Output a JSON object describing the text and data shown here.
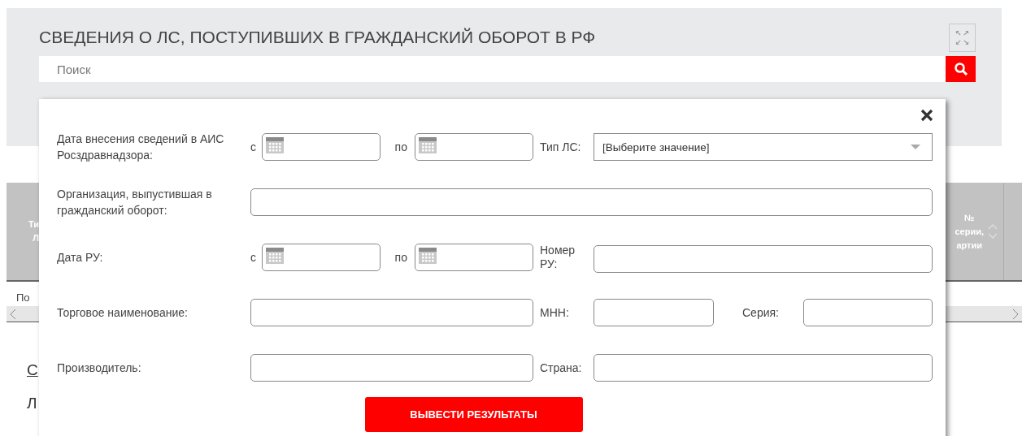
{
  "header": {
    "title": "СВЕДЕНИЯ О ЛС, ПОСТУПИВШИХ В ГРАЖДАНСКИЙ ОБОРОТ В РФ",
    "search": {
      "placeholder": "Поиск"
    }
  },
  "table": {
    "columns": [
      {
        "lines": [
          "Ти",
          "Л"
        ]
      },
      {
        "lines": [
          "№",
          "серии,",
          "артии"
        ]
      }
    ]
  },
  "background_texts": [
    {
      "kind": "note",
      "text": "По"
    },
    {
      "kind": "link",
      "text": "С"
    },
    {
      "kind": "heading",
      "text": "Л"
    }
  ],
  "filter": {
    "rows": [
      {
        "label": "Дата внесения сведений в АИС Росздравнадзора:",
        "items": [
          {
            "kind": "dates",
            "from": "с",
            "to": "по"
          },
          {
            "kind": "select",
            "label": "Тип ЛС:",
            "value": "[Выберите значение]"
          }
        ]
      },
      {
        "label": "Организация, выпустившая в гражданский оборот:",
        "items": [
          {
            "kind": "text"
          }
        ]
      },
      {
        "label": "Дата РУ:",
        "items": [
          {
            "kind": "dates",
            "from": "с",
            "to": "по"
          },
          {
            "kind": "text",
            "label": "Номер РУ:"
          }
        ]
      },
      {
        "label": "Торговое наименование:",
        "items": [
          {
            "kind": "text"
          },
          {
            "kind": "text",
            "label": "МНН:"
          },
          {
            "kind": "text",
            "label": "Серия:"
          }
        ]
      },
      {
        "label": "Производитель:",
        "items": [
          {
            "kind": "text"
          },
          {
            "kind": "text",
            "label": "Страна:"
          }
        ]
      }
    ],
    "submit": "ВЫВЕСТИ РЕЗУЛЬТАТЫ"
  }
}
